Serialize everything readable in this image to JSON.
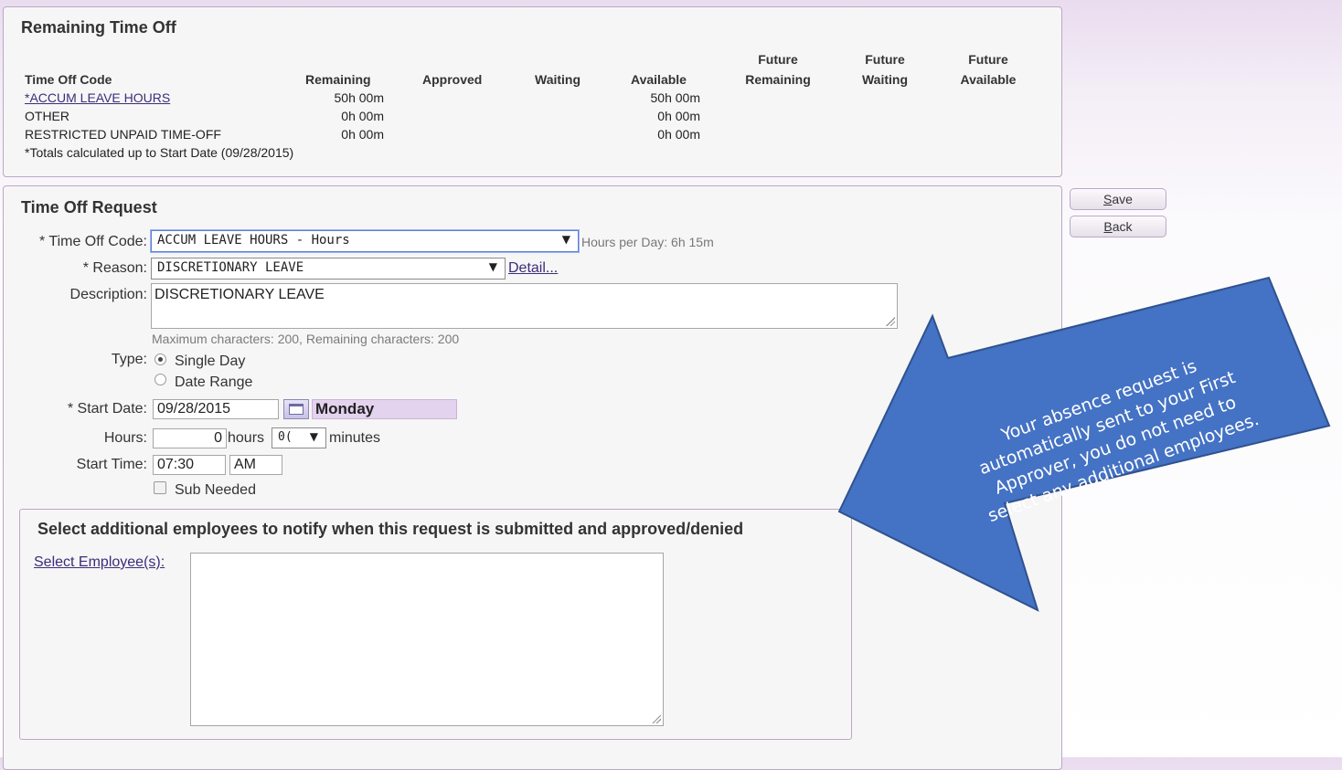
{
  "remaining": {
    "title": "Remaining Time Off",
    "headers": {
      "code": "Time Off Code",
      "remaining": "Remaining",
      "approved": "Approved",
      "waiting": "Waiting",
      "available": "Available",
      "future": "Future",
      "future_remaining": "Remaining",
      "future_waiting": "Waiting",
      "future_available": "Available"
    },
    "rows": [
      {
        "code": "*ACCUM LEAVE HOURS",
        "remaining": "50h 00m",
        "available": "50h 00m"
      },
      {
        "code": "OTHER",
        "remaining": "0h 00m",
        "available": "0h 00m"
      },
      {
        "code": "RESTRICTED UNPAID TIME-OFF",
        "remaining": "0h 00m",
        "available": "0h 00m"
      }
    ],
    "footnote": "*Totals calculated up to Start Date (09/28/2015)"
  },
  "request": {
    "title": "Time Off Request",
    "time_off_code_label": "* Time Off Code:",
    "time_off_code_value": "ACCUM LEAVE HOURS - Hours",
    "hours_per_day": "Hours per Day: 6h 15m",
    "reason_label": "* Reason:",
    "reason_value": "DISCRETIONARY LEAVE",
    "detail_link": "Detail...",
    "description_label": "Description:",
    "description_value": "DISCRETIONARY LEAVE",
    "max_chars_hint": "Maximum characters: 200, Remaining characters: 200",
    "type_label": "Type:",
    "type_single": "Single Day",
    "type_range": "Date Range",
    "start_date_label": "* Start Date:",
    "start_date_value": "09/28/2015",
    "day_name": "Monday",
    "hours_label": "Hours:",
    "hours_value": "0",
    "hours_unit": "hours",
    "minutes_value": "0(",
    "minutes_unit": "minutes",
    "start_time_label": "Start Time:",
    "start_time_value": "07:30",
    "ampm_value": "AM",
    "sub_needed": "Sub Needed"
  },
  "notify": {
    "title": "Select additional employees to notify when this request is submitted and approved/denied",
    "select_link": "Select Employee(s):"
  },
  "buttons": {
    "save_first": "S",
    "save_rest": "ave",
    "back_first": "B",
    "back_rest": "ack"
  },
  "callout": {
    "lines": [
      "Your absence request is",
      "automatically sent to your First",
      "Approver, you do not need to",
      "select any additional employees."
    ],
    "fill": "#4472c4",
    "stroke": "#2f528f"
  }
}
